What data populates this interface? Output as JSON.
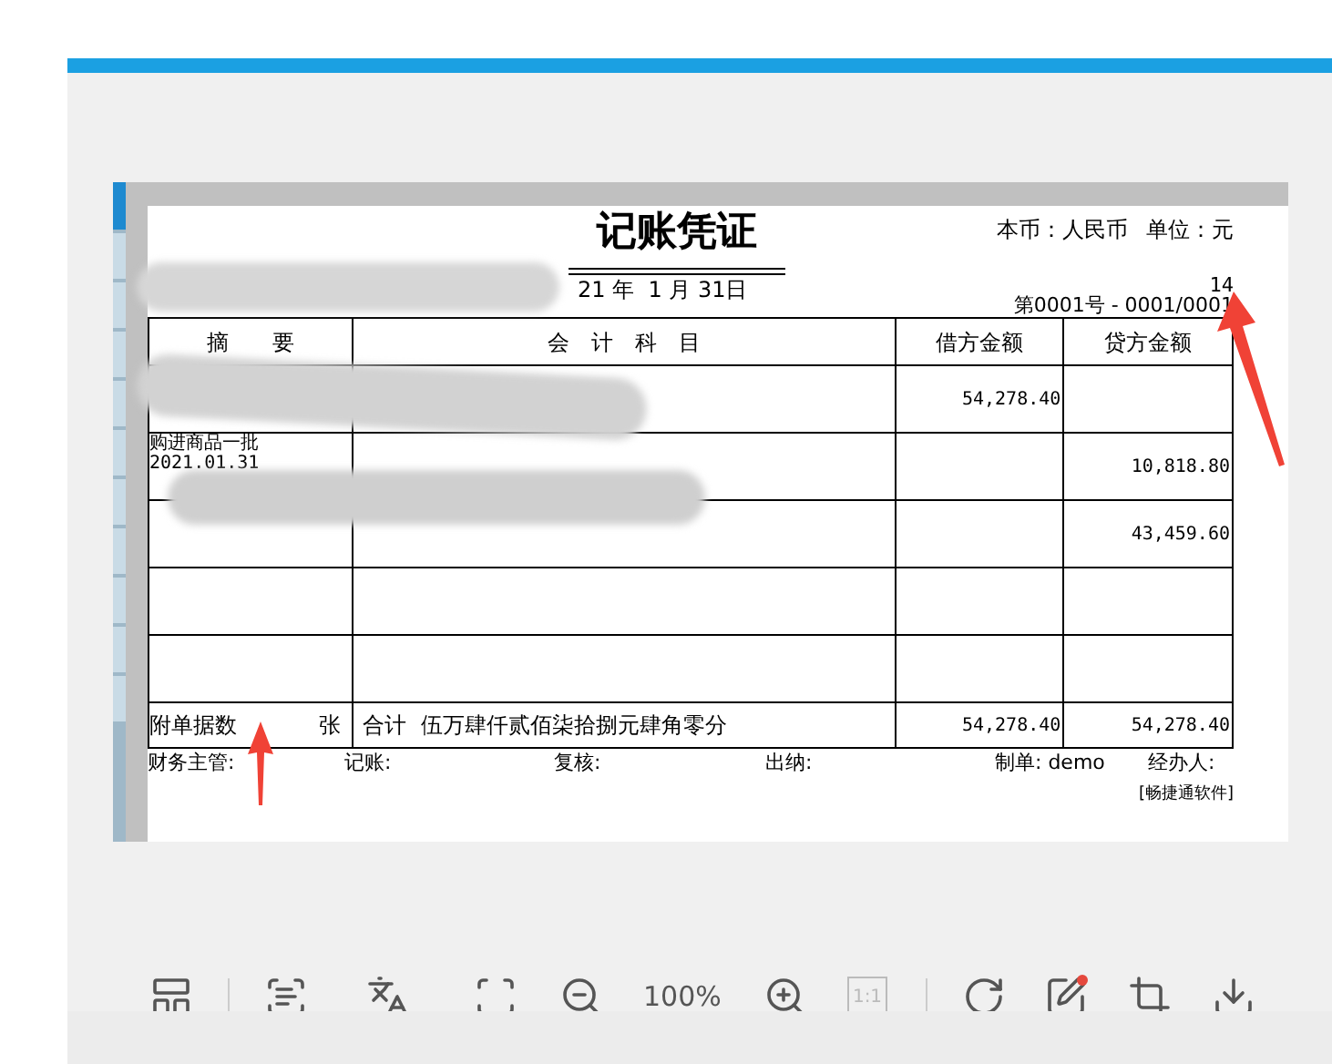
{
  "voucher": {
    "title": "记账凭证",
    "date": "21 年  1 月 31日",
    "currency": "本币：人民币",
    "unit": "单位：元",
    "attachments_count": "14",
    "number": "第0001号 - 0001/0001",
    "columns": [
      "摘　　要",
      "会　计　科　目",
      "借方金额",
      "贷方金额"
    ],
    "rows": [
      {
        "debit": "54,278.40"
      },
      {
        "summary": [
          "购进商品一批",
          "2021.01.31"
        ],
        "credit": "10,818.80"
      },
      {
        "credit": "43,459.60"
      },
      {},
      {}
    ],
    "total": {
      "attachments": "附单据数",
      "sheets": "张",
      "label": "合计",
      "amount_words": "伍万肆仟贰佰柒拾捌元肆角零分",
      "debit": "54,278.40",
      "credit": "54,278.40"
    },
    "signatures": [
      "财务主管:",
      "记账:",
      "复核:",
      "出纳:",
      "制单: demo",
      "经办人:"
    ],
    "software": "[畅捷通软件]"
  },
  "toolbar": {
    "zoom": "100%",
    "actual_size": "1:1"
  }
}
